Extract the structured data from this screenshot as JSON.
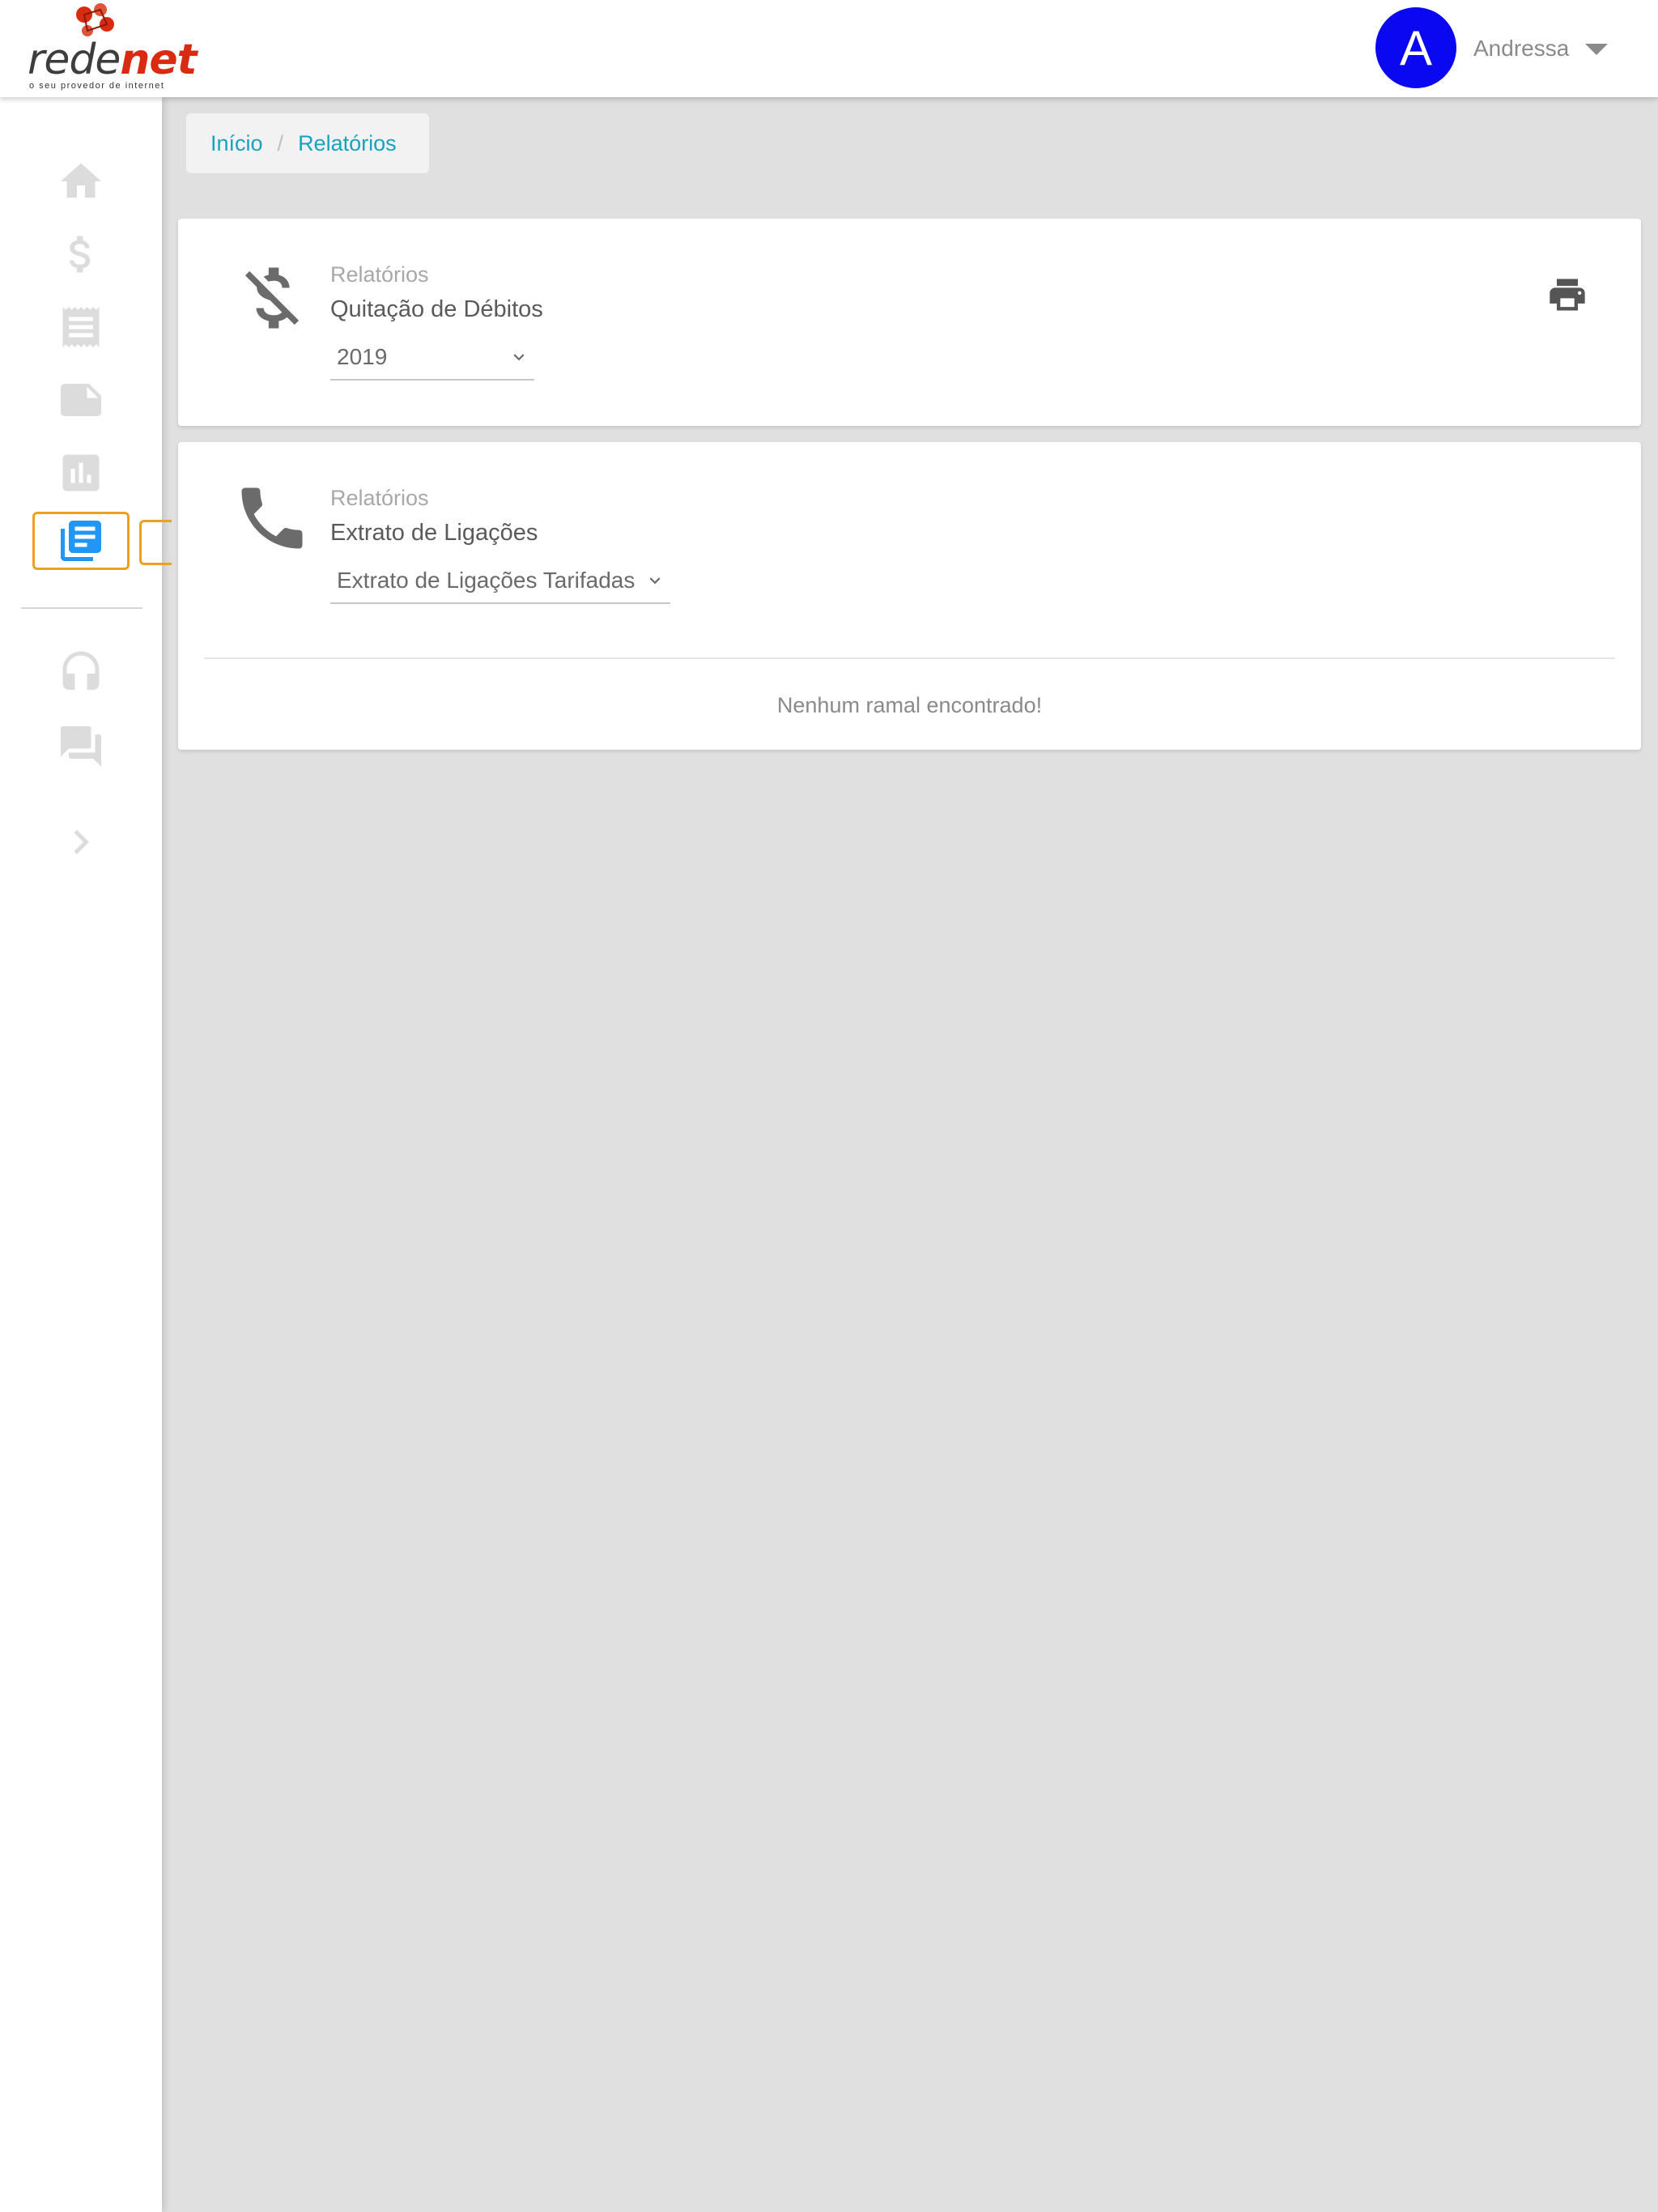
{
  "header": {
    "logo": {
      "name_dark": "rede",
      "name_accent": "net",
      "tagline": "o seu provedor de internet"
    },
    "user": {
      "initial": "A",
      "name": "Andressa"
    }
  },
  "sidebar": {
    "items": [
      {
        "icon": "home-icon",
        "active": false
      },
      {
        "icon": "dollar-icon",
        "active": false
      },
      {
        "icon": "receipt-icon",
        "active": false
      },
      {
        "icon": "note-icon",
        "active": false
      },
      {
        "icon": "bar-chart-icon",
        "active": false
      },
      {
        "icon": "reports-icon",
        "active": true
      },
      {
        "icon": "headset-icon",
        "active": false
      },
      {
        "icon": "forum-icon",
        "active": false
      },
      {
        "icon": "chevron-right-icon",
        "active": false
      }
    ]
  },
  "breadcrumb": {
    "home": "Início",
    "separator": "/",
    "current": "Relatórios"
  },
  "cards": [
    {
      "category": "Relatórios",
      "title": "Quitação de Débitos",
      "select_value": "2019",
      "icon": "money-off-icon",
      "action_icon": "print-icon"
    },
    {
      "category": "Relatórios",
      "title": "Extrato de Ligações",
      "select_value": "Extrato de Ligações Tarifadas",
      "icon": "phone-icon",
      "empty_message": "Nenhum ramal encontrado!"
    }
  ],
  "colors": {
    "accent": "#17a2c0",
    "avatar": "#0a08f0",
    "active_nav": "#2196f3",
    "active_outline": "#f0a020",
    "brand_red": "#d82b12"
  }
}
